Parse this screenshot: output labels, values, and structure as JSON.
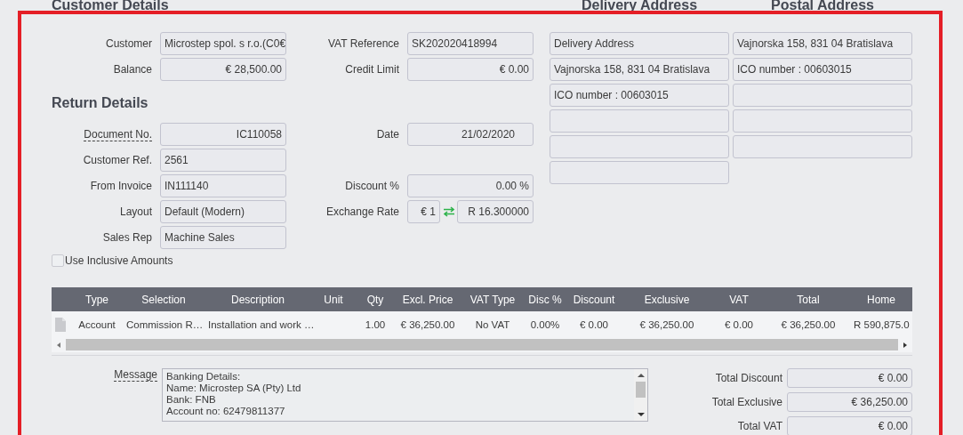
{
  "customer_details": {
    "title": "Customer Details",
    "left": [
      {
        "label": "Customer",
        "value": "Microstep spol. s r.o.(C0€",
        "kind": "text"
      },
      {
        "label": "Balance",
        "value": "€ 28,500.00",
        "kind": "amount"
      }
    ],
    "right": [
      {
        "label": "VAT Reference",
        "value": "SK202020418994",
        "kind": "text"
      },
      {
        "label": "Credit Limit",
        "value": "€ 0.00",
        "kind": "amount"
      }
    ]
  },
  "return_details": {
    "title": "Return Details",
    "rows": [
      {
        "left": {
          "label": "Document No.",
          "value": "IC110058",
          "kind": "amount",
          "hint": true
        },
        "right": {
          "label": "Date",
          "value": "21/02/2020",
          "kind": "date"
        }
      },
      {
        "left": {
          "label": "Customer Ref.",
          "value": "2561",
          "kind": "text",
          "hint": false
        }
      },
      {
        "left": {
          "label": "From Invoice",
          "value": "IN111140",
          "kind": "text",
          "hint": false
        },
        "right": {
          "label": "Discount %",
          "value": "0.00 %",
          "kind": "amount"
        }
      },
      {
        "left": {
          "label": "Layout",
          "value": "Default (Modern)",
          "kind": "text",
          "hint": false
        },
        "right": {
          "label": "Exchange Rate",
          "kind": "exchange",
          "from": "€ 1",
          "to": "R 16.300000"
        }
      },
      {
        "left": {
          "label": "Sales Rep",
          "value": "Machine Sales",
          "kind": "text",
          "hint": false
        }
      }
    ]
  },
  "use_inclusive_amounts": {
    "label": "Use Inclusive Amounts",
    "checked": false
  },
  "delivery_address": {
    "title": "Delivery Address",
    "lines": [
      "Delivery Address",
      "Vajnorska 158, 831 04 Bratislava",
      "ICO number : 00603015"
    ]
  },
  "postal_address": {
    "title": "Postal Address",
    "lines": [
      "Vajnorska 158, 831 04 Bratislava",
      "ICO number : 00603015"
    ]
  },
  "table": {
    "columns": [
      "Type",
      "Selection",
      "Description",
      "Unit",
      "Qty",
      "Excl. Price",
      "VAT Type",
      "Disc %",
      "Discount",
      "Exclusive",
      "VAT",
      "Total",
      "Home"
    ],
    "rows": [
      {
        "cells": [
          "Account",
          "Commission R…",
          "Installation and work …",
          "",
          "1.00",
          "€ 36,250.00",
          "No VAT",
          "0.00%",
          "€ 0.00",
          "€ 36,250.00",
          "€ 0.00",
          "€ 36,250.00",
          "R 590,875.0"
        ]
      }
    ]
  },
  "message": {
    "label": "Message",
    "lines": [
      "Banking Details:",
      "Name: Microstep SA (Pty) Ltd",
      "Bank: FNB",
      "Account no: 62479811377"
    ]
  },
  "totals": [
    {
      "label": "Total Discount",
      "value": "€ 0.00"
    },
    {
      "label": "Total Exclusive",
      "value": "€ 36,250.00"
    },
    {
      "label": "Total VAT",
      "value": "€ 0.00"
    }
  ]
}
